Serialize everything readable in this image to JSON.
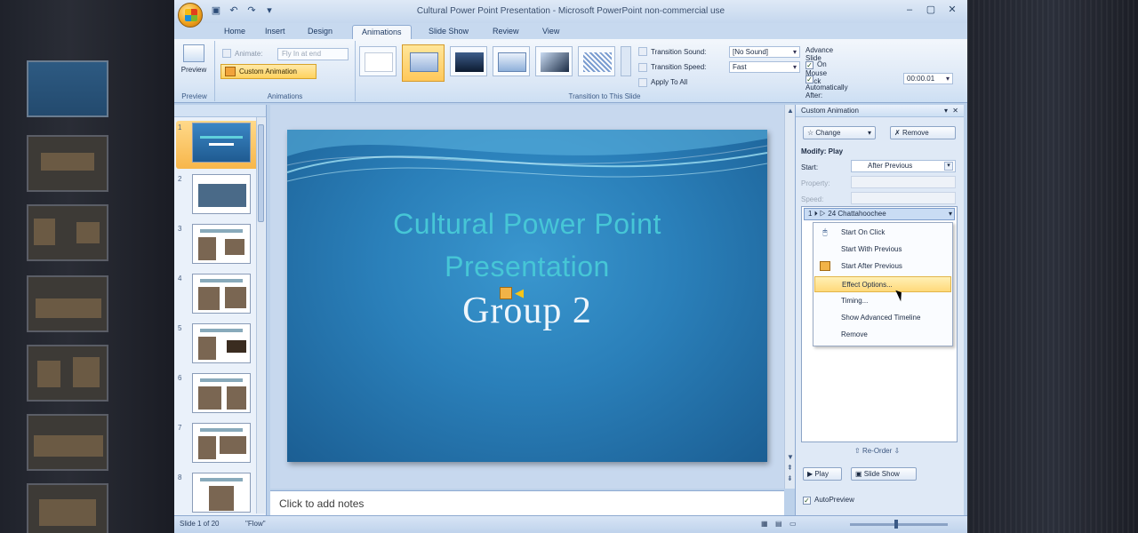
{
  "window": {
    "title": "Cultural Power Point Presentation - Microsoft PowerPoint non-commercial use"
  },
  "ribbon_tabs": [
    "Home",
    "Insert",
    "Design",
    "Animations",
    "Slide Show",
    "Review",
    "View"
  ],
  "ribbon": {
    "preview_label": "Preview",
    "preview_group_label": "Preview",
    "animate_label": "Animate:",
    "animate_value": "Fly In at end",
    "custom_animation_label": "Custom Animation",
    "animations_group_label": "Animations",
    "transition_sound_label": "Transition Sound:",
    "transition_sound_value": "[No Sound]",
    "transition_speed_label": "Transition Speed:",
    "transition_speed_value": "Fast",
    "apply_all_label": "Apply To All",
    "transition_group_label": "Transition to This Slide",
    "advance_label": "Advance Slide",
    "on_click_label": "On Mouse Click",
    "auto_after_label": "Automatically After:",
    "auto_after_value": "00:00.01"
  },
  "slides_pane": {
    "slide_numbers": [
      "1",
      "2",
      "3",
      "4",
      "5",
      "6",
      "7",
      "8"
    ]
  },
  "slide": {
    "title_line1": "Cultural Power Point",
    "title_line2": "Presentation",
    "subtitle": "Group 2"
  },
  "notes_placeholder": "Click to add notes",
  "status": {
    "slide_count": "Slide 1 of 20",
    "theme": "\"Flow\""
  },
  "custom_animation": {
    "header": "Custom Animation",
    "change_label": "Change",
    "remove_label": "Remove",
    "modify_label": "Modify: Play",
    "start_label": "Start:",
    "start_value": "After Previous",
    "property_label": "Property:",
    "speed_label": "Speed:",
    "effect_item": "24 Chattahoochee",
    "effect_index": "1",
    "menu": [
      "Start On Click",
      "Start With Previous",
      "Start After Previous",
      "Effect Options...",
      "Timing...",
      "Show Advanced Timeline",
      "Remove"
    ],
    "reorder_label": "Re-Order",
    "play_label": "Play",
    "slideshow_label": "Slide Show",
    "autopreview_label": "AutoPreview"
  },
  "colors": {
    "accent": "#ffd25e",
    "slide_title": "#46c6d6",
    "slide_bg": "#2a7fb9"
  }
}
